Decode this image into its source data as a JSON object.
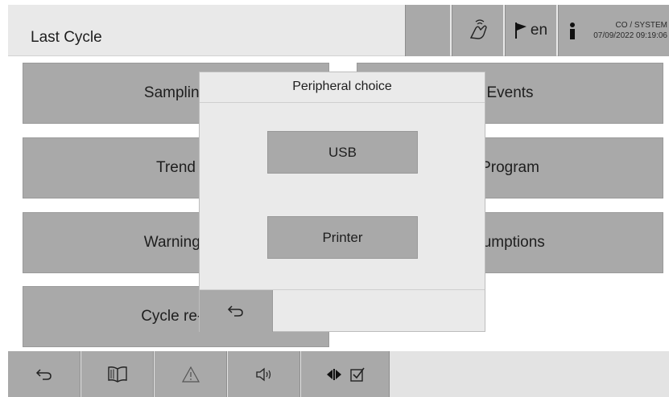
{
  "header": {
    "title": "Last Cycle",
    "language": "en",
    "user": "CO / SYSTEM",
    "datetime": "07/09/2022 09:19:06"
  },
  "tiles": {
    "left": [
      "Sampling",
      "Trend",
      "Warnings",
      "Cycle re-p"
    ],
    "right": [
      "Events",
      "Program",
      "sumptions"
    ]
  },
  "dialog": {
    "title": "Peripheral choice",
    "usb_label": "USB",
    "printer_label": "Printer"
  },
  "toolbar": {
    "icons": [
      "back-icon",
      "manual-book-icon",
      "warning-icon",
      "speaker-icon",
      "arrows-icon",
      "checkbox-icon"
    ]
  },
  "colors": {
    "button": "#a9a9a9",
    "header_bg": "#e9e9e9",
    "dialog_bg": "#eaeaea",
    "toolbar_bg": "#e3e3e3"
  }
}
